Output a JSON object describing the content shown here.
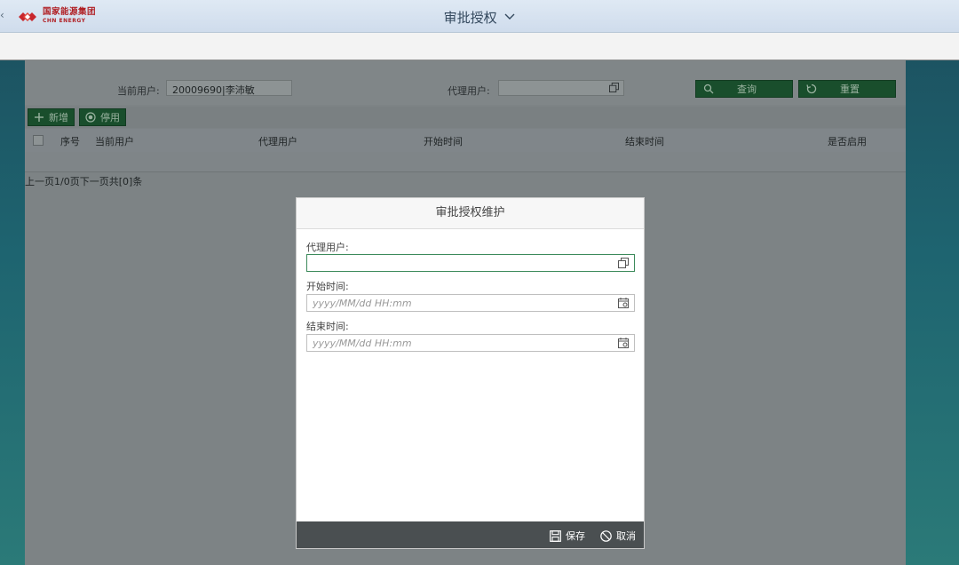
{
  "header": {
    "back": "‹",
    "logo_cn": "国家能源集团",
    "logo_en": "CHN ENERGY",
    "title": "审批授权"
  },
  "filter": {
    "current_user_label": "当前用户:",
    "current_user_value": "20009690|李沛敏",
    "agent_user_label": "代理用户:",
    "agent_user_value": "",
    "search_label": "查询",
    "reset_label": "重置"
  },
  "toolbar": {
    "add_label": "新增",
    "disable_label": "停用"
  },
  "table": {
    "columns": [
      "序号",
      "当前用户",
      "代理用户",
      "开始时间",
      "结束时间",
      "是否启用"
    ],
    "rows": []
  },
  "pager": {
    "text": "上一页1/0页下一页共[0]条"
  },
  "dialog": {
    "title": "审批授权维护",
    "agent_user_label": "代理用户:",
    "agent_user_value": "",
    "start_time_label": "开始时间:",
    "start_time_placeholder": "yyyy/MM/dd HH:mm",
    "end_time_label": "结束时间:",
    "end_time_placeholder": "yyyy/MM/dd HH:mm",
    "save_label": "保存",
    "cancel_label": "取消"
  },
  "colors": {
    "brand_red": "#b01f24",
    "button_green": "#194e2c",
    "focus_green": "#3c8a5b"
  },
  "icons": {
    "value_help": "value-help-icon",
    "calendar": "calendar-icon",
    "search": "search-icon",
    "reset": "reset-icon",
    "add": "plus-icon",
    "disable": "stop-circle-icon",
    "save": "save-icon",
    "cancel": "cancel-icon"
  }
}
